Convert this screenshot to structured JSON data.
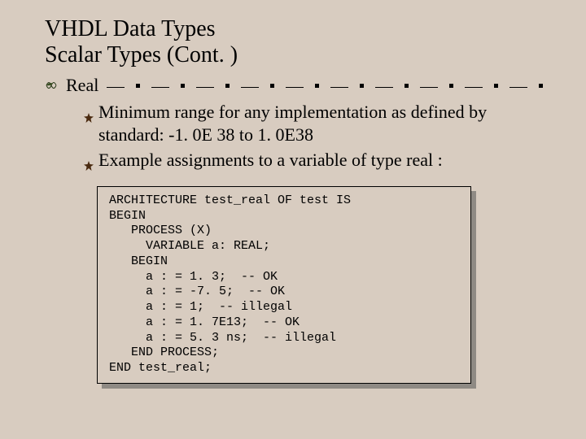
{
  "title_line1": "VHDL Data Types",
  "title_line2": "Scalar Types (Cont. )",
  "level1": "Real",
  "bullets": [
    "Minimum range for any implementation as defined by standard:  -1. 0E 38 to 1. 0E38",
    "Example assignments to a variable of type real :"
  ],
  "code": "ARCHITECTURE test_real OF test IS\nBEGIN\n   PROCESS (X)\n     VARIABLE a: REAL;\n   BEGIN\n     a : = 1. 3;  -- OK\n     a : = -7. 5;  -- OK\n     a : = 1;  -- illegal\n     a : = 1. 7E13;  -- OK\n     a : = 5. 3 ns;  -- illegal\n   END PROCESS;\nEND test_real;"
}
